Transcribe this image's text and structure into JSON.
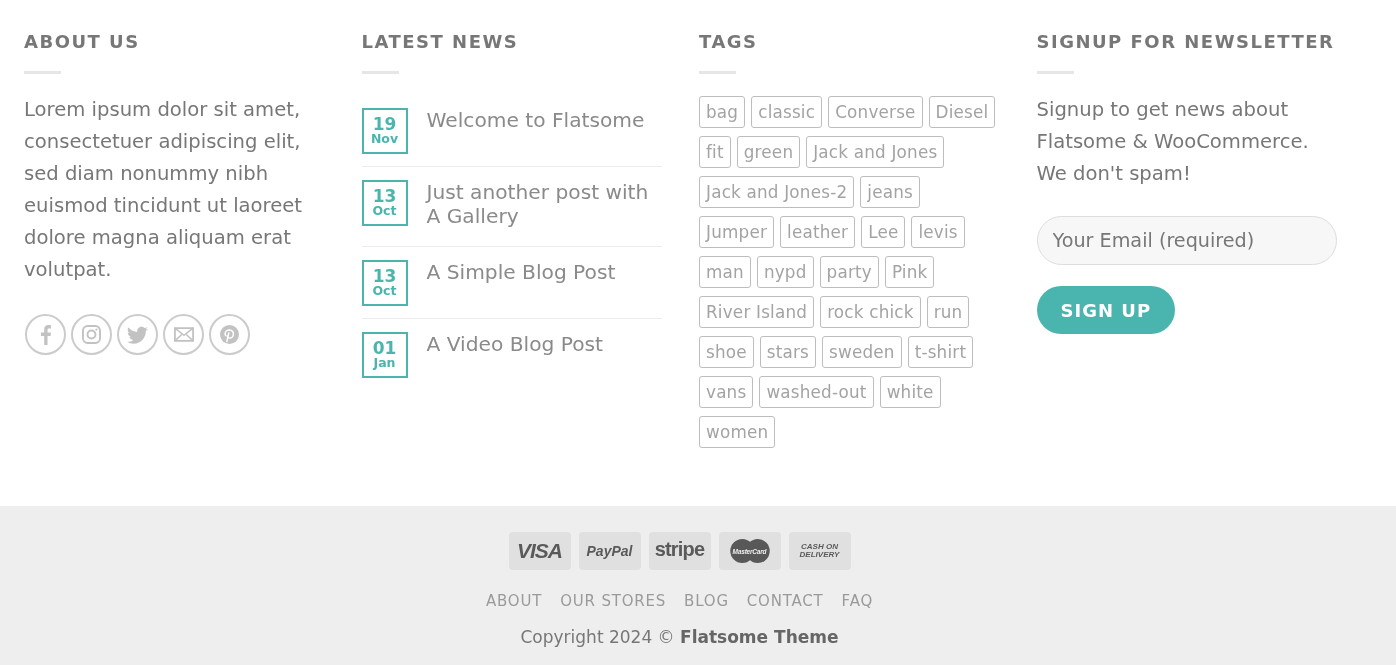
{
  "about": {
    "heading": "ABOUT US",
    "text": "Lorem ipsum dolor sit amet, consectetuer adipiscing elit, sed diam nonummy nibh euismod tincidunt ut laoreet dolore magna aliquam erat volutpat."
  },
  "latest_news": {
    "heading": "LATEST NEWS",
    "posts": [
      {
        "day": "19",
        "month": "Nov",
        "title": "Welcome to Flatsome"
      },
      {
        "day": "13",
        "month": "Oct",
        "title": "Just another post with A Gallery"
      },
      {
        "day": "13",
        "month": "Oct",
        "title": "A Simple Blog Post"
      },
      {
        "day": "01",
        "month": "Jan",
        "title": "A Video Blog Post"
      }
    ]
  },
  "tags": {
    "heading": "TAGS",
    "items": [
      "bag",
      "classic",
      "Converse",
      "Diesel",
      "fit",
      "green",
      "Jack and Jones",
      "Jack and Jones-2",
      "jeans",
      "Jumper",
      "leather",
      "Lee",
      "levis",
      "man",
      "nypd",
      "party",
      "Pink",
      "River Island",
      "rock chick",
      "run",
      "shoe",
      "stars",
      "sweden",
      "t-shirt",
      "vans",
      "washed-out",
      "white",
      "women"
    ]
  },
  "newsletter": {
    "heading": "SIGNUP FOR NEWSLETTER",
    "text": "Signup to get news about Flatsome & WooCommerce. We don't spam!",
    "email_field": {
      "placeholder": "Your Email (required)"
    },
    "button": "SIGN UP"
  },
  "payment_methods": [
    {
      "kind": "visa",
      "label": "VISA"
    },
    {
      "kind": "paypal",
      "label": "PayPal"
    },
    {
      "kind": "stripe",
      "label": "stripe"
    },
    {
      "kind": "mastercard",
      "label": "MasterCard"
    },
    {
      "kind": "cash",
      "label": "CASH ON DELIVERY"
    }
  ],
  "footer_links": [
    "ABOUT",
    "OUR STORES",
    "BLOG",
    "CONTACT",
    "FAQ"
  ],
  "copyright": "Copyright 2024 © **Flatsome Theme**"
}
